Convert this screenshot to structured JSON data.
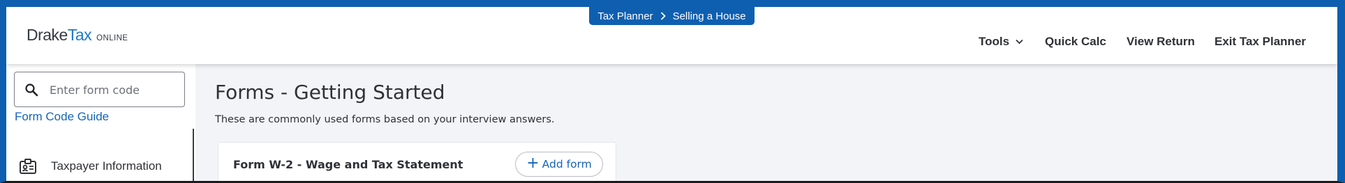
{
  "header": {
    "logo": {
      "part1": "Drake",
      "part2": "Tax",
      "part3": "ONLINE"
    },
    "breadcrumb": [
      "Tax Planner",
      "Selling a House"
    ],
    "nav": {
      "tools_label": "Tools",
      "quick_calc_label": "Quick Calc",
      "view_return_label": "View Return",
      "exit_label": "Exit Tax Planner"
    }
  },
  "sidebar": {
    "search": {
      "placeholder": "Enter form code",
      "value": ""
    },
    "guide_label": "Form Code Guide",
    "items": [
      {
        "label": "Taxpayer Information",
        "icon": "id-badge-icon"
      }
    ]
  },
  "main": {
    "title": "Forms - Getting Started",
    "subtitle": "These are commonly used forms based on your interview answers.",
    "forms": [
      {
        "title": "Form W-2 - Wage and Tax Statement",
        "add_label": "Add form"
      }
    ]
  },
  "colors": {
    "accent": "#0f5fb0",
    "link": "#1565b8",
    "main_bg": "#f2f4f8",
    "text": "#2f3136"
  }
}
